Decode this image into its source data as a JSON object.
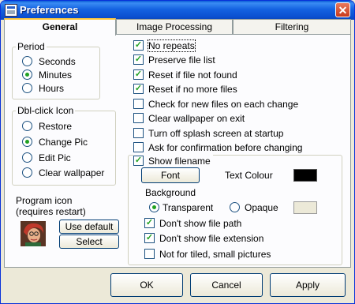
{
  "window": {
    "title": "Preferences"
  },
  "tabs": [
    "General",
    "Image Processing",
    "Filtering"
  ],
  "period": {
    "legend": "Period",
    "options": [
      "Seconds",
      "Minutes",
      "Hours"
    ],
    "selected": "Minutes"
  },
  "dblclick": {
    "legend": "Dbl-click Icon",
    "options": [
      "Restore",
      "Change Pic",
      "Edit Pic",
      "Clear wallpaper"
    ],
    "selected": "Change Pic"
  },
  "program_icon": {
    "label_line1": "Program icon",
    "label_line2": "(requires restart)",
    "use_default": "Use default",
    "select": "Select"
  },
  "options": [
    {
      "label": "No repeats",
      "checked": true
    },
    {
      "label": "Preserve file list",
      "checked": true
    },
    {
      "label": "Reset if file not found",
      "checked": true
    },
    {
      "label": "Reset if no more files",
      "checked": true
    },
    {
      "label": "Check for new files on each change",
      "checked": false
    },
    {
      "label": "Clear wallpaper on exit",
      "checked": false
    },
    {
      "label": "Turn off splash screen at startup",
      "checked": false
    },
    {
      "label": "Ask for confirmation before changing",
      "checked": false
    }
  ],
  "show_filename": {
    "label": "Show filename",
    "checked": true,
    "font_button": "Font",
    "text_colour_label": "Text Colour",
    "text_colour": "#000000",
    "background_label": "Background",
    "bg_options": [
      "Transparent",
      "Opaque"
    ],
    "bg_selected": "Transparent",
    "sub_options": [
      {
        "label": "Don't show file path",
        "checked": true
      },
      {
        "label": "Don't show file extension",
        "checked": true
      },
      {
        "label": "Not for tiled, small pictures",
        "checked": false
      }
    ]
  },
  "buttons": {
    "ok": "OK",
    "cancel": "Cancel",
    "apply": "Apply"
  }
}
